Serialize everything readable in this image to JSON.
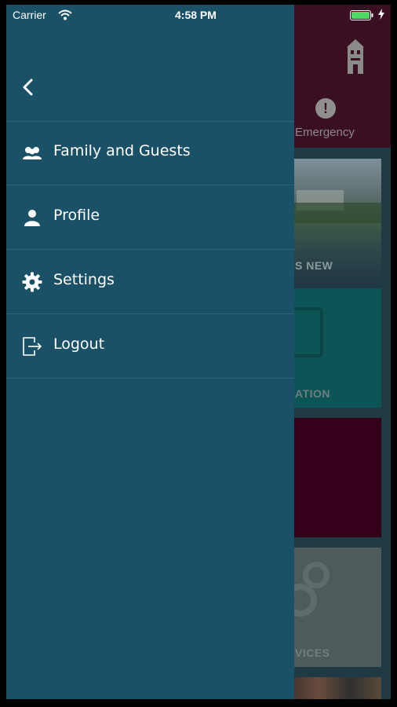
{
  "status_bar": {
    "carrier": "Carrier",
    "time": "4:58 PM"
  },
  "drawer": {
    "menu_items": [
      {
        "label": "Family and Guests",
        "icon": "people-icon"
      },
      {
        "label": "Profile",
        "icon": "person-icon"
      },
      {
        "label": "Settings",
        "icon": "gear-icon"
      },
      {
        "label": "Logout",
        "icon": "logout-icon"
      }
    ]
  },
  "background": {
    "emergency_label": "Emergency",
    "cards": [
      {
        "label": "S NEW"
      },
      {
        "label": "ATION"
      },
      {
        "label": ""
      },
      {
        "label": "VICES"
      }
    ]
  },
  "colors": {
    "drawer_bg": "#1a5166",
    "divider": "#2a6579",
    "header_bg": "#3a0f22",
    "location_card": "#0d5457",
    "magenta_card": "#34001a",
    "services_card": "#4f5a5a",
    "battery": "#4cd964"
  }
}
